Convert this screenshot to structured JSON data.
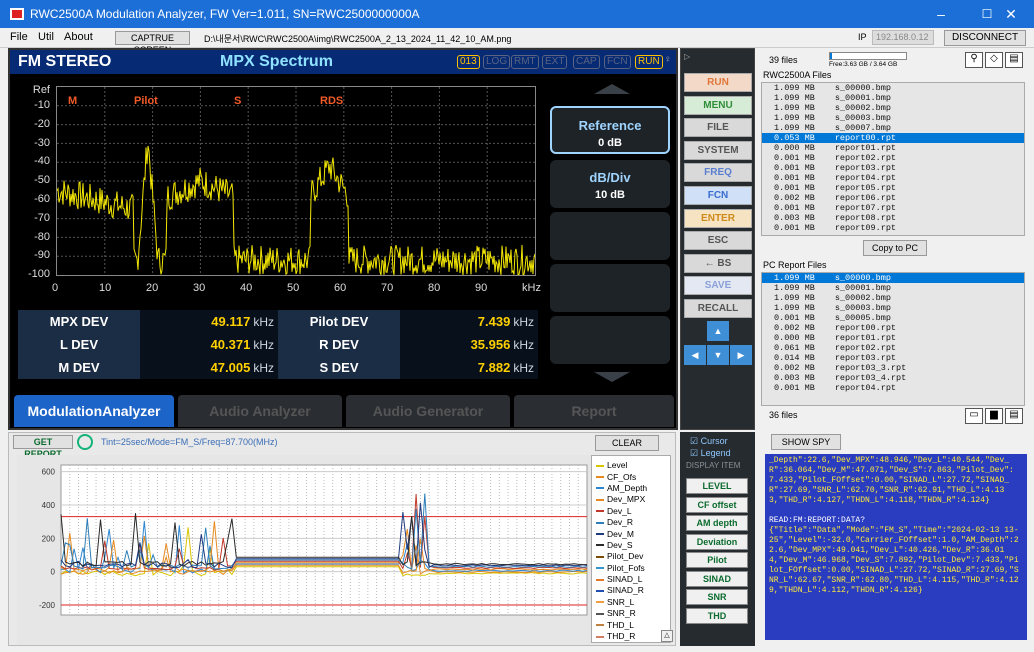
{
  "window": {
    "title": "RWC2500A Modulation Analyzer, FW Ver=1.011, SN=RWC2500000000A",
    "min": "–",
    "max": "☐",
    "close": "✕"
  },
  "menu": {
    "file": "File",
    "util": "Util",
    "about": "About",
    "capture": "CAPTRUE SCREEN",
    "path": "D:\\내문서\\RWC\\RWC2500A\\img\\RWC2500A_2_13_2024_11_42_10_AM.png",
    "ip_label": "IP",
    "ip_value": "192.168.0.12",
    "disconnect": "DISCONNECT"
  },
  "screen": {
    "mode": "FM STEREO",
    "title": "MPX Spectrum",
    "badges": [
      "013",
      "LOG",
      "RMT",
      "EXT",
      "CAP",
      "FCN",
      "RUN"
    ],
    "ref_label": "Ref",
    "ylabels": [
      "-10",
      "-20",
      "-30",
      "-40",
      "-50",
      "-60",
      "-70",
      "-80",
      "-90",
      "-100"
    ],
    "xlabels": [
      "0",
      "10",
      "20",
      "30",
      "40",
      "50",
      "60",
      "70",
      "80",
      "90"
    ],
    "xunit": "kHz",
    "markers": [
      "M",
      "Pilot",
      "S",
      "RDS"
    ],
    "side": {
      "ref_title": "Reference",
      "ref_value": "0 dB",
      "div_title": "dB/Div",
      "div_value": "10 dB"
    },
    "meas": [
      {
        "l1": "MPX DEV",
        "v1": "49.117",
        "l2": "Pilot DEV",
        "v2": "7.439"
      },
      {
        "l1": "L DEV",
        "v1": "40.371",
        "l2": "R DEV",
        "v2": "35.956"
      },
      {
        "l1": "M DEV",
        "v1": "47.005",
        "l2": "S DEV",
        "v2": "7.882"
      }
    ],
    "unit": "kHz",
    "tabs": [
      "ModulationAnalyzer",
      "Audio Analyzer",
      "Audio Generator",
      "Report"
    ]
  },
  "buttons": [
    "RUN",
    "MENU",
    "FILE",
    "SYSTEM",
    "FREQ",
    "FCN",
    "ENTER",
    "ESC",
    "← BS",
    "SAVE",
    "RECALL"
  ],
  "right": {
    "count": "39 files",
    "free": "Free:3.63 GB / 3.64 GB",
    "rwc_title": "RWC2500A Files",
    "rwc_files": [
      [
        "1.099 MB",
        "s_00000.bmp"
      ],
      [
        "1.099 MB",
        "s_00001.bmp"
      ],
      [
        "1.099 MB",
        "s_00002.bmp"
      ],
      [
        "1.099 MB",
        "s_00003.bmp"
      ],
      [
        "1.099 MB",
        "s_00007.bmp"
      ],
      [
        "0.053 MB",
        "report00.rpt"
      ],
      [
        "0.000 MB",
        "report01.rpt"
      ],
      [
        "0.001 MB",
        "report02.rpt"
      ],
      [
        "0.001 MB",
        "report03.rpt"
      ],
      [
        "0.001 MB",
        "report04.rpt"
      ],
      [
        "0.001 MB",
        "report05.rpt"
      ],
      [
        "0.002 MB",
        "report06.rpt"
      ],
      [
        "0.001 MB",
        "report07.rpt"
      ],
      [
        "0.003 MB",
        "report08.rpt"
      ],
      [
        "0.001 MB",
        "report09.rpt"
      ]
    ],
    "copy": "Copy to PC",
    "pc_title": "PC Report Files",
    "pc_files": [
      [
        "1.099 MB",
        "s_00000.bmp"
      ],
      [
        "1.099 MB",
        "s_00001.bmp"
      ],
      [
        "1.099 MB",
        "s_00002.bmp"
      ],
      [
        "1.099 MB",
        "s_00003.bmp"
      ],
      [
        "0.001 MB",
        "s_00005.bmp"
      ],
      [
        "0.002 MB",
        "report00.rpt"
      ],
      [
        "0.000 MB",
        "report01.rpt"
      ],
      [
        "0.061 MB",
        "report02.rpt"
      ],
      [
        "0.014 MB",
        "report03.rpt"
      ],
      [
        "0.002 MB",
        "report03_3.rpt"
      ],
      [
        "0.003 MB",
        "report03_4.rpt"
      ],
      [
        "0.001 MB",
        "report04.rpt"
      ]
    ],
    "pc_count": "36 files"
  },
  "chart": {
    "get_report": "GET REPORT",
    "info": "Tint=25sec/Mode=FM_S/Freq=87.700(MHz)",
    "clear": "CLEAR",
    "ylabels": [
      "600",
      "400",
      "200",
      "0",
      "-200"
    ],
    "legend": [
      "Level",
      "CF_Ofs",
      "AM_Depth",
      "Dev_MPX",
      "Dev_L",
      "Dev_R",
      "Dev_M",
      "Dev_S",
      "Pilot_Dev",
      "Pilot_Fofs",
      "SINAD_L",
      "SINAD_R",
      "SNR_L",
      "SNR_R",
      "THD_L",
      "THD_R"
    ],
    "legend_colors": [
      "#d9c400",
      "#e58a1f",
      "#2f86d0",
      "#e58a1f",
      "#c0392b",
      "#2c7fb8",
      "#203a80",
      "#2a2a2a",
      "#7a4b00",
      "#3399cc",
      "#e07a2a",
      "#1f4fb0",
      "#f0a040",
      "#555",
      "#c08040",
      "#d08060"
    ]
  },
  "display": {
    "cursor": "Cursor",
    "legend": "Legend",
    "title": "DISPLAY ITEM",
    "items": [
      "LEVEL",
      "CF offset",
      "AM depth",
      "Deviation",
      "Pilot",
      "SINAD",
      "SNR",
      "THD"
    ]
  },
  "spy": {
    "button": "SHOW SPY",
    "text1": "_Depth\":22.6,\"Dev_MPX\":48.946,\"Dev_L\":40.544,\"Dev_R\":36.064,\"Dev_M\":47.071,\"Dev_S\":7.863,\"Pilot_Dev\":7.433,\"Pilot_FOffset\":0.00,\"SINAD_L\":27.72,\"SINAD_R\":27.69,\"SNR_L\":62.70,\"SNR_R\":62.91,\"THD_L\":4.133,\"THD_R\":4.127,\"THDN_L\":4.118,\"THDN_R\":4.124}",
    "cmd": "READ:FM:REPORT:DATA?",
    "text2": "{\"Title\":\"Data\",\"Mode\":\"FM_S\",\"Time\":\"2024-02-13 13-25\",\"Level\":-32.0,\"Carrier_FOffset\":1.0,\"AM_Depth\":22.6,\"Dev_MPX\":49.041,\"Dev_L\":40.426,\"Dev_R\":36.014,\"Dev_M\":46.968,\"Dev_S\":7.892,\"Pilot_Dev\":7.433,\"Pilot_FOffset\":0.00,\"SINAD_L\":27.72,\"SINAD_R\":27.69,\"SNR_L\":62.67,\"SNR_R\":62.80,\"THD_L\":4.115,\"THD_R\":4.129,\"THDN_L\":4.112,\"THDN_R\":4.126}"
  }
}
